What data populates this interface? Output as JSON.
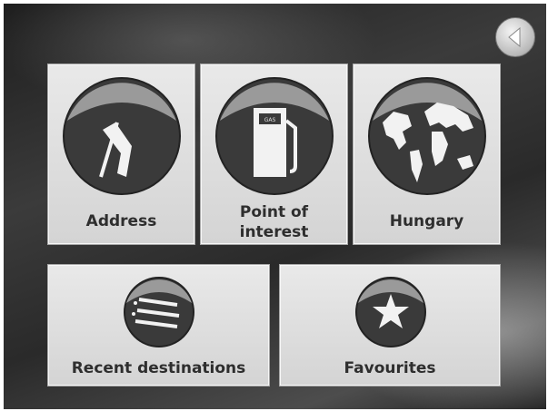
{
  "menu": {
    "address_label": "Address",
    "poi_label_line1": "Point of",
    "poi_label_line2": "interest",
    "country_label": "Hungary",
    "recent_label": "Recent destinations",
    "favourites_label": "Favourites"
  },
  "icons": {
    "back": "back-arrow-icon",
    "address": "flag-icon",
    "poi": "fuel-pump-icon",
    "country": "globe-icon",
    "recent": "recent-list-icon",
    "favourites": "star-icon"
  },
  "pump_sign": "GAS"
}
